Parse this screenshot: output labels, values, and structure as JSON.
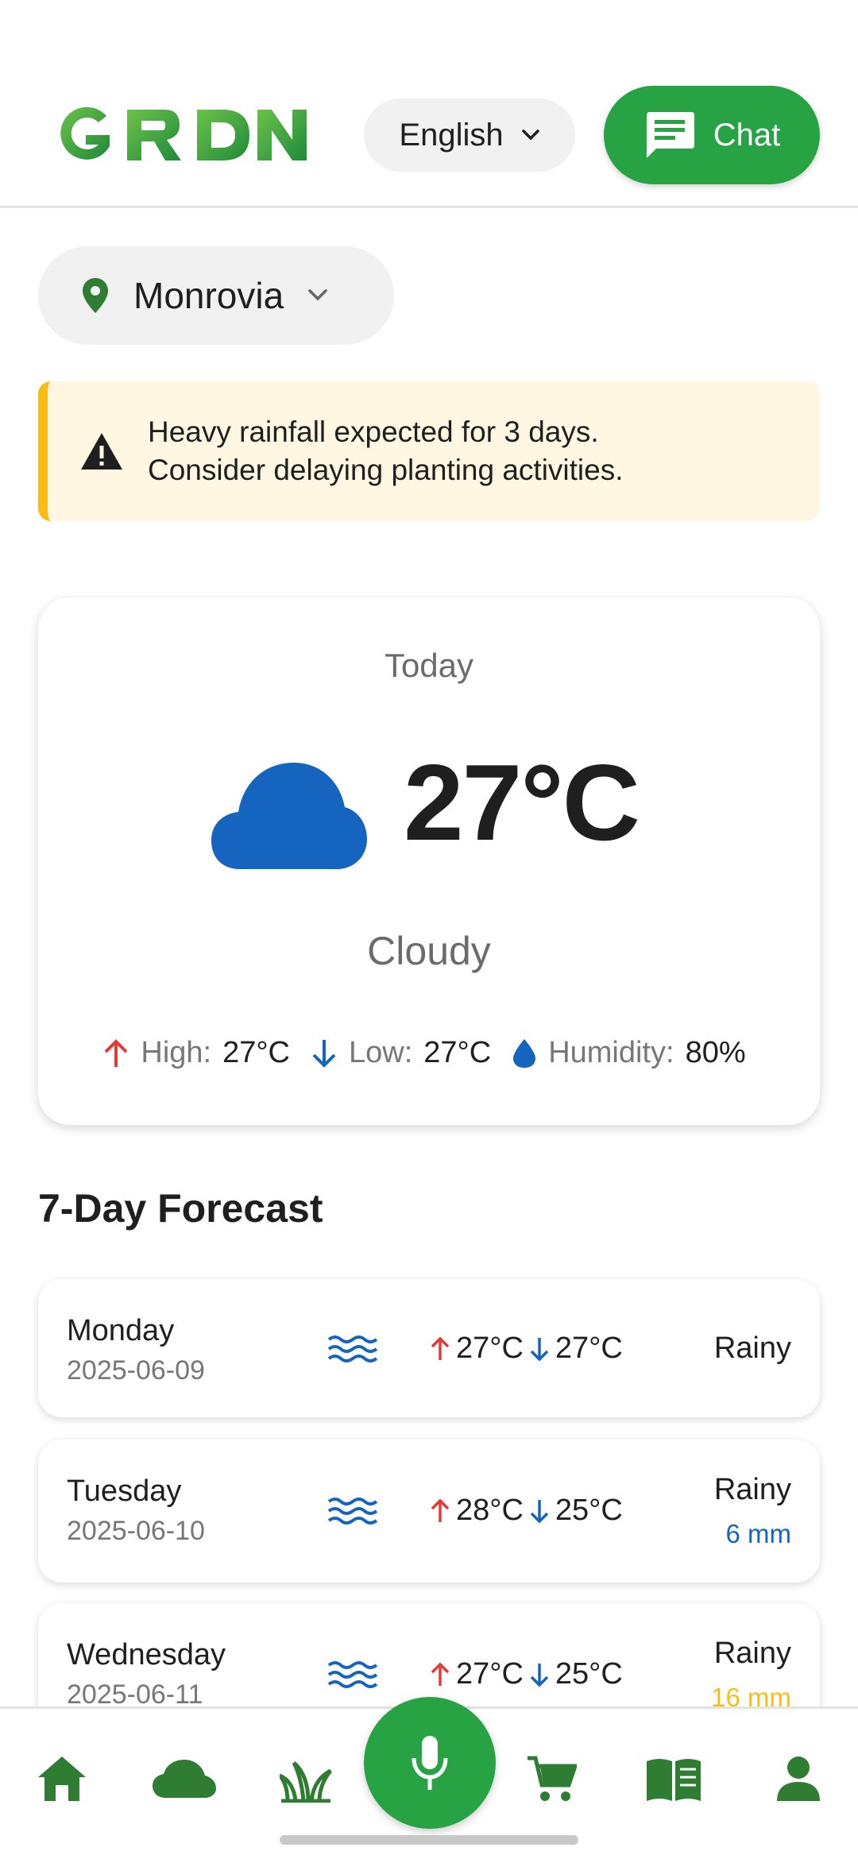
{
  "header": {
    "logo_text": "GRDN",
    "language": "English",
    "chat_label": "Chat"
  },
  "location": {
    "name": "Monrovia"
  },
  "alert": {
    "line1": "Heavy rainfall expected for 3 days.",
    "line2": "Consider delaying planting activities."
  },
  "today": {
    "label": "Today",
    "temperature": "27°C",
    "condition": "Cloudy",
    "high_label": "High:",
    "high_value": "27°C",
    "low_label": "Low:",
    "low_value": "27°C",
    "humidity_label": "Humidity:",
    "humidity_value": "80%"
  },
  "forecast": {
    "title": "7-Day Forecast",
    "days": [
      {
        "day": "Monday",
        "date": "2025-06-09",
        "high": "27°C",
        "low": "27°C",
        "condition": "Rainy",
        "rain": ""
      },
      {
        "day": "Tuesday",
        "date": "2025-06-10",
        "high": "28°C",
        "low": "25°C",
        "condition": "Rainy",
        "rain": "6 mm"
      },
      {
        "day": "Wednesday",
        "date": "2025-06-11",
        "high": "27°C",
        "low": "25°C",
        "condition": "Rainy",
        "rain": "16 mm"
      }
    ]
  },
  "colors": {
    "brand_green": "#27a344",
    "cloud_blue": "#1565c0",
    "alert_yellow": "#f6bd16",
    "high_red": "#e53935",
    "rain_orange": "#f6bd16"
  },
  "nav": {
    "items": [
      "home-icon",
      "weather-icon",
      "crops-icon",
      "microphone-icon",
      "market-icon",
      "guide-icon",
      "profile-icon"
    ]
  }
}
